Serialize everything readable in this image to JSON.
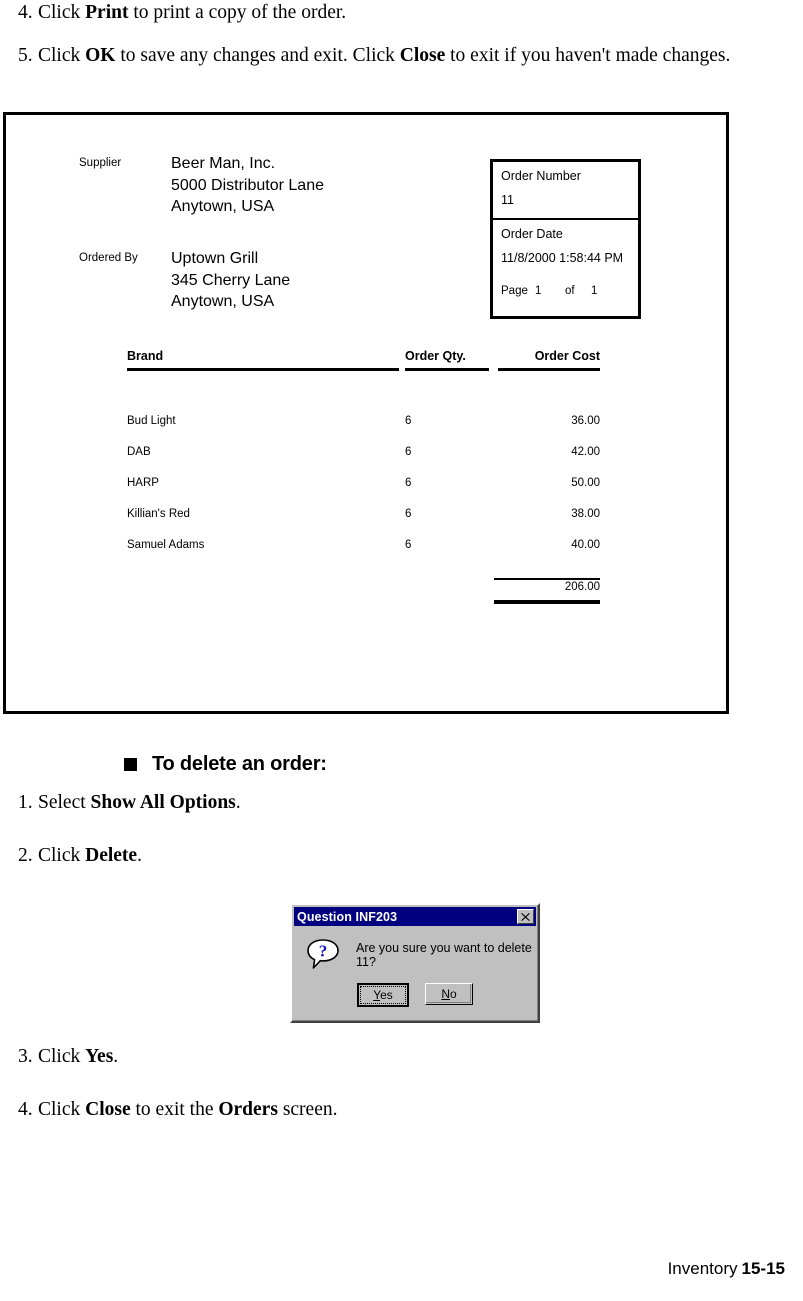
{
  "top_steps": [
    {
      "number": "4.",
      "parts": [
        {
          "t": "Click ",
          "b": false
        },
        {
          "t": "Print",
          "b": true
        },
        {
          "t": " to print a copy of the order.",
          "b": false
        }
      ]
    },
    {
      "number": "5.",
      "parts": [
        {
          "t": "Click ",
          "b": false
        },
        {
          "t": "OK",
          "b": true
        },
        {
          "t": " to save any changes and exit. Click ",
          "b": false
        },
        {
          "t": "Close",
          "b": true
        },
        {
          "t": " to exit if you haven't made changes.",
          "b": false
        }
      ]
    }
  ],
  "report": {
    "supplier_label": "Supplier",
    "supplier_address": "Beer Man, Inc.\n5000 Distributor Lane\nAnytown, USA",
    "ordered_by_label": "Ordered By",
    "ordered_by_address": "Uptown Grill\n345 Cherry Lane\nAnytown, USA",
    "order_info": {
      "order_number_label": "Order Number",
      "order_number_value": "11",
      "order_date_label": "Order Date",
      "order_date_value": "11/8/2000 1:58:44 PM",
      "page_label": "Page",
      "page_current": "1",
      "page_of": "of",
      "page_total": "1"
    },
    "table": {
      "headers": [
        "Brand",
        "Order Qty.",
        "Order Cost"
      ],
      "rows": [
        {
          "brand": "Bud Light",
          "qty": "6",
          "cost": "36.00"
        },
        {
          "brand": "DAB",
          "qty": "6",
          "cost": "42.00"
        },
        {
          "brand": "HARP",
          "qty": "6",
          "cost": "50.00"
        },
        {
          "brand": "Killian's Red",
          "qty": "6",
          "cost": "38.00"
        },
        {
          "brand": "Samuel Adams",
          "qty": "6",
          "cost": "40.00"
        }
      ],
      "total": "206.00"
    }
  },
  "section": {
    "bullet_icon": "filled-square-icon",
    "heading": "To delete an order:",
    "steps": [
      {
        "number": "1.",
        "parts": [
          {
            "t": "Select ",
            "b": false
          },
          {
            "t": "Show All Options",
            "b": true
          },
          {
            "t": ".",
            "b": false
          }
        ]
      },
      {
        "number": "2.",
        "parts": [
          {
            "t": "Click ",
            "b": false
          },
          {
            "t": "Delete",
            "b": true
          },
          {
            "t": ".",
            "b": false
          }
        ]
      }
    ],
    "steps_after": [
      {
        "number": "3.",
        "parts": [
          {
            "t": "Click ",
            "b": false
          },
          {
            "t": "Yes",
            "b": true
          },
          {
            "t": ".",
            "b": false
          }
        ]
      },
      {
        "number": "4.",
        "parts": [
          {
            "t": "Click ",
            "b": false
          },
          {
            "t": "Close",
            "b": true
          },
          {
            "t": " to exit the ",
            "b": false
          },
          {
            "t": "Orders",
            "b": true
          },
          {
            "t": " screen.",
            "b": false
          }
        ]
      }
    ]
  },
  "dialog": {
    "title": "Question INF203",
    "close_icon": "close-icon",
    "icon": "question-bubble-icon",
    "message": "Are you sure you want to delete 11?",
    "buttons": [
      {
        "label": "Yes",
        "accel": "Y",
        "default": true
      },
      {
        "label": "No",
        "accel": "N",
        "default": false
      }
    ],
    "titlebar_color": "#000080",
    "face_color": "#c0c0c0"
  },
  "footer": {
    "chapter": "Inventory",
    "page_number": "15-15"
  }
}
